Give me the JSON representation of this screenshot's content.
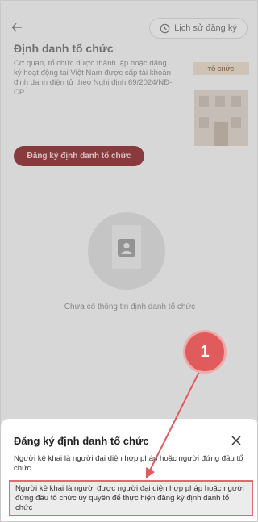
{
  "header": {
    "back_icon": "back-arrow-icon",
    "history_label": "Lịch sử đăng ký",
    "history_icon": "history-clock-icon"
  },
  "page": {
    "title": "Định danh tổ chức",
    "description": "Cơ quan, tổ chức được thành lập hoặc đăng ký hoạt động tại Việt Nam được cấp tài khoản định danh điện tử theo Nghị định 69/2024/NĐ-CP",
    "illustration_sign": "TỔ CHỨC",
    "register_button": "Đăng ký định danh tổ chức",
    "empty_text": "Chưa có thông tin định danh tổ chức"
  },
  "annotation": {
    "badge_number": "1",
    "color": "#e05b5b"
  },
  "sheet": {
    "title": "Đăng ký định danh tổ chức",
    "close_icon": "close-icon",
    "options": [
      "Người kê khai là người đại diện hợp pháp hoặc người đứng đầu tổ chức",
      "Người kê khai là người được người đại diện hợp pháp hoặc người đứng đầu tổ chức ủy quyền để thực hiện đăng ký định danh tổ chức"
    ]
  },
  "colors": {
    "brand": "#b3262c",
    "highlight_border": "#e06b6b"
  }
}
